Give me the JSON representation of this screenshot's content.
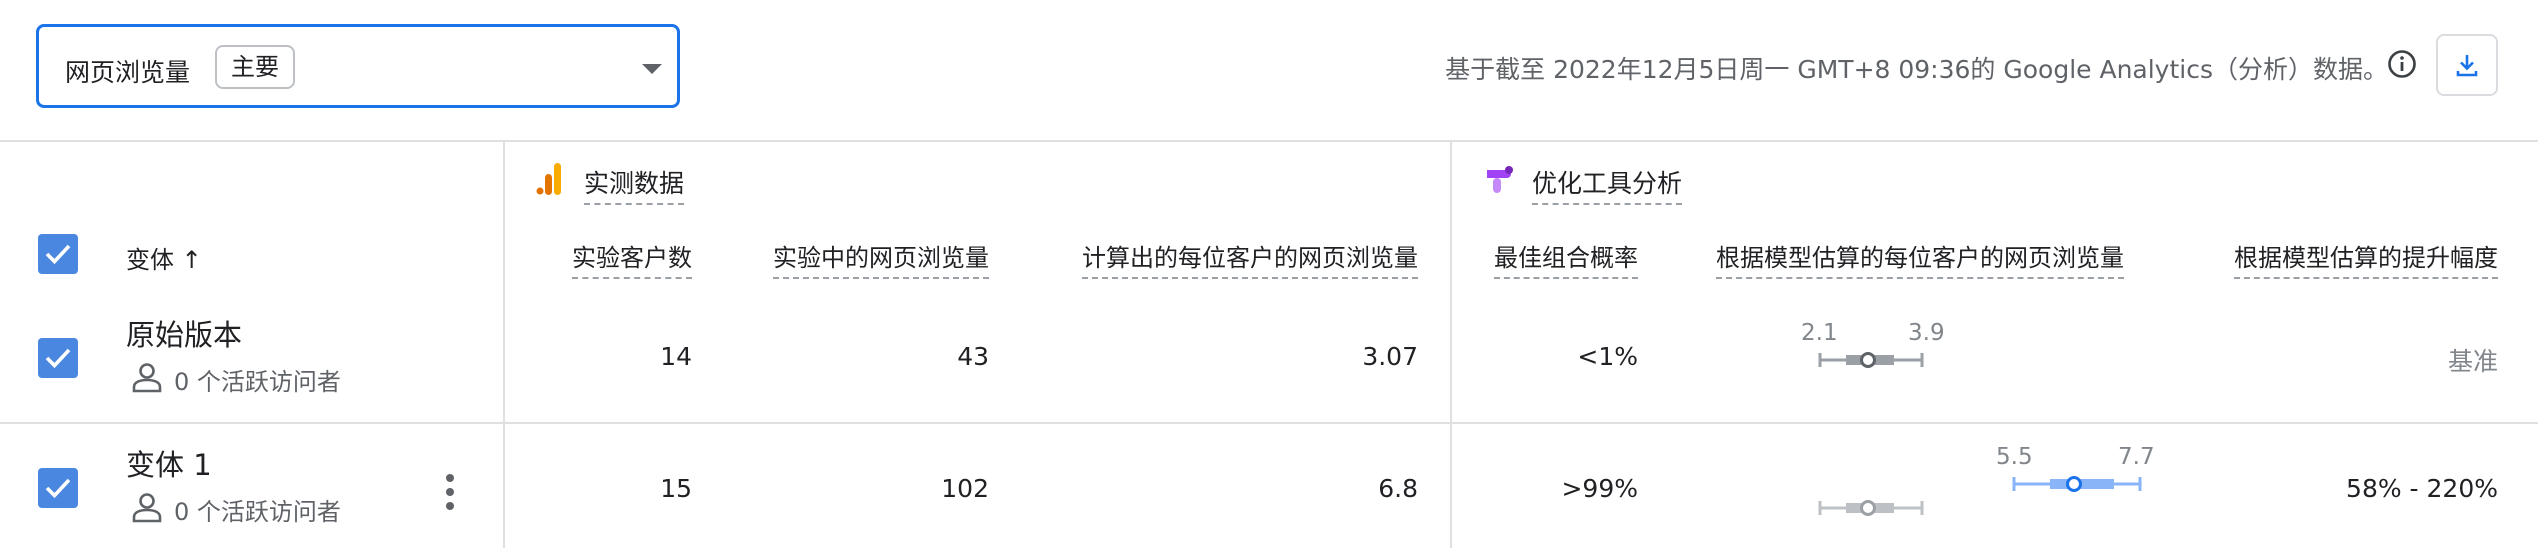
{
  "metric_selector": {
    "label": "网页浏览量",
    "badge": "主要"
  },
  "freshness_text": "基于截至 2022年12月5日周一 GMT+8 09:36的 Google Analytics（分析）数据。",
  "groups": {
    "observed": "实测数据",
    "optimize": "优化工具分析"
  },
  "columns": {
    "variant": "变体 ↑",
    "experiment_users": "实验客户数",
    "experiment_pageviews": "实验中的网页浏览量",
    "calc_pageviews_per_user": "计算出的每位客户的网页浏览量",
    "prob_best": "最佳组合概率",
    "model_pageviews_per_user": "根据模型估算的每位客户的网页浏览量",
    "model_improvement": "根据模型估算的提升幅度"
  },
  "rows": [
    {
      "name": "原始版本",
      "active_visitors": "0 个活跃访问者",
      "experiment_users": "14",
      "experiment_pageviews": "43",
      "calc_pageviews_per_user": "3.07",
      "prob_best": "<1%",
      "ci_low": "2.1",
      "ci_high": "3.9",
      "improvement": "基准"
    },
    {
      "name": "变体 1",
      "active_visitors": "0 个活跃访问者",
      "experiment_users": "15",
      "experiment_pageviews": "102",
      "calc_pageviews_per_user": "6.8",
      "prob_best": ">99%",
      "ci_low": "5.5",
      "ci_high": "7.7",
      "improvement": "58% - 220%"
    }
  ],
  "colors": {
    "accent": "#1a73e8",
    "checkbox": "#4a87e0",
    "ci_baseline": "#9aa0a6",
    "ci_variant": "#8ab4f8",
    "ci_variant_dark": "#1a73e8",
    "analytics_orange": "#f9ab00",
    "analytics_dark_orange": "#e37400",
    "optimize_purple": "#a142f4"
  },
  "icons": {
    "metric_caret": "caret-down-icon",
    "info": "info-icon",
    "download": "download-icon",
    "checkbox": "checkbox-checked-icon",
    "person": "person-icon",
    "more": "more-vert-icon",
    "analytics": "google-analytics-icon",
    "optimize": "google-optimize-icon"
  }
}
